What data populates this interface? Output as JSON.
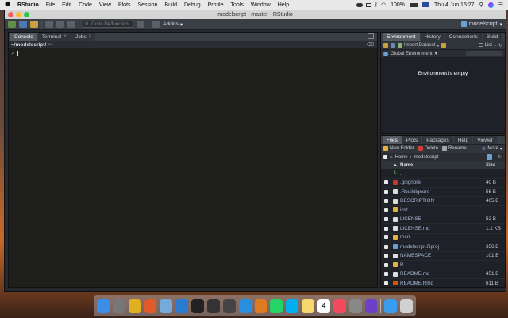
{
  "menubar": {
    "apple": "",
    "app_name": "RStudio",
    "items": [
      "File",
      "Edit",
      "Code",
      "View",
      "Plots",
      "Session",
      "Build",
      "Debug",
      "Profile",
      "Tools",
      "Window",
      "Help"
    ],
    "battery": "100%",
    "datetime": "Thu 4 Jun  15:27"
  },
  "window": {
    "title": "modelscript - master - RStudio"
  },
  "toolbar": {
    "goto_placeholder": "Go to file/function",
    "addins_label": "Addins",
    "project_label": "modelscript"
  },
  "console_pane": {
    "tabs": [
      {
        "label": "Console",
        "active": true
      },
      {
        "label": "Terminal",
        "active": false
      },
      {
        "label": "Jobs",
        "active": false
      }
    ],
    "path": "~/modelscript/",
    "prompt": ">"
  },
  "env_pane": {
    "tabs": [
      {
        "label": "Environment",
        "active": true
      },
      {
        "label": "History",
        "active": false
      },
      {
        "label": "Connections",
        "active": false
      },
      {
        "label": "Build",
        "active": false
      }
    ],
    "import_label": "Import Dataset",
    "list_label": "List",
    "scope_label": "Global Environment",
    "empty_message": "Environment is empty"
  },
  "files_pane": {
    "tabs": [
      {
        "label": "Files",
        "active": true
      },
      {
        "label": "Plots",
        "active": false
      },
      {
        "label": "Packages",
        "active": false
      },
      {
        "label": "Help",
        "active": false
      },
      {
        "label": "Viewer",
        "active": false
      }
    ],
    "toolbar": {
      "new_folder": "New Folder",
      "delete": "Delete",
      "rename": "Rename",
      "more": "More"
    },
    "breadcrumb": [
      "Home",
      "modelscript"
    ],
    "header": {
      "name": "Name",
      "size": "Size"
    },
    "parent_label": "..",
    "files": [
      {
        "name": ".gitignore",
        "size": "40 B",
        "icon": "git-file-icon",
        "color": "#c0392b"
      },
      {
        "name": ".Rbuildignore",
        "size": "56 B",
        "icon": "text-file-icon",
        "color": "#dddddd"
      },
      {
        "name": "DESCRIPTION",
        "size": "405 B",
        "icon": "text-file-icon",
        "color": "#dddddd"
      },
      {
        "name": "inst",
        "size": "",
        "icon": "folder-icon",
        "color": "#e2b440"
      },
      {
        "name": "LICENSE",
        "size": "52 B",
        "icon": "text-file-icon",
        "color": "#dddddd"
      },
      {
        "name": "LICENSE.md",
        "size": "1.1 KB",
        "icon": "markdown-file-icon",
        "color": "#dddddd"
      },
      {
        "name": "man",
        "size": "",
        "icon": "folder-icon",
        "color": "#e2b440"
      },
      {
        "name": "modelscript.Rproj",
        "size": "356 B",
        "icon": "rproj-icon",
        "color": "#6a9fd8"
      },
      {
        "name": "NAMESPACE",
        "size": "101 B",
        "icon": "text-file-icon",
        "color": "#dddddd"
      },
      {
        "name": "R",
        "size": "",
        "icon": "folder-icon",
        "color": "#e2b440"
      },
      {
        "name": "README.md",
        "size": "451 B",
        "icon": "markdown-file-icon",
        "color": "#dddddd"
      },
      {
        "name": "README.Rmd",
        "size": "611 B",
        "icon": "rmarkdown-file-icon",
        "color": "#d35400"
      }
    ]
  },
  "dock": {
    "apps": [
      {
        "icon": "finder-icon",
        "color": "#3a8ee6"
      },
      {
        "icon": "launchpad-icon",
        "color": "#777777"
      },
      {
        "icon": "chrome-icon",
        "color": "#e0b020"
      },
      {
        "icon": "brave-icon",
        "color": "#e05a2a"
      },
      {
        "icon": "rstudio-icon",
        "color": "#75aadb"
      },
      {
        "icon": "vscode-icon",
        "color": "#2a7ad2"
      },
      {
        "icon": "terminal-icon",
        "color": "#222222"
      },
      {
        "icon": "activity-monitor-icon",
        "color": "#333333"
      },
      {
        "icon": "tableplus-icon",
        "color": "#444444"
      },
      {
        "icon": "safari-icon",
        "color": "#2a8ee0"
      },
      {
        "icon": "books-icon",
        "color": "#e07a20"
      },
      {
        "icon": "whatsapp-icon",
        "color": "#25d366"
      },
      {
        "icon": "skype-icon",
        "color": "#00aff0"
      },
      {
        "icon": "notes-icon",
        "color": "#f5d76e"
      },
      {
        "icon": "calendar-icon",
        "color": "#ffffff"
      },
      {
        "icon": "music-icon",
        "color": "#f24a5e"
      },
      {
        "icon": "system-preferences-icon",
        "color": "#888888"
      },
      {
        "icon": "github-desktop-icon",
        "color": "#6e40c9"
      },
      {
        "icon": "app-store-icon",
        "color": "#3a9ef0"
      },
      {
        "icon": "trash-icon",
        "color": "#d0d0d0"
      }
    ],
    "calendar_day": "4"
  }
}
